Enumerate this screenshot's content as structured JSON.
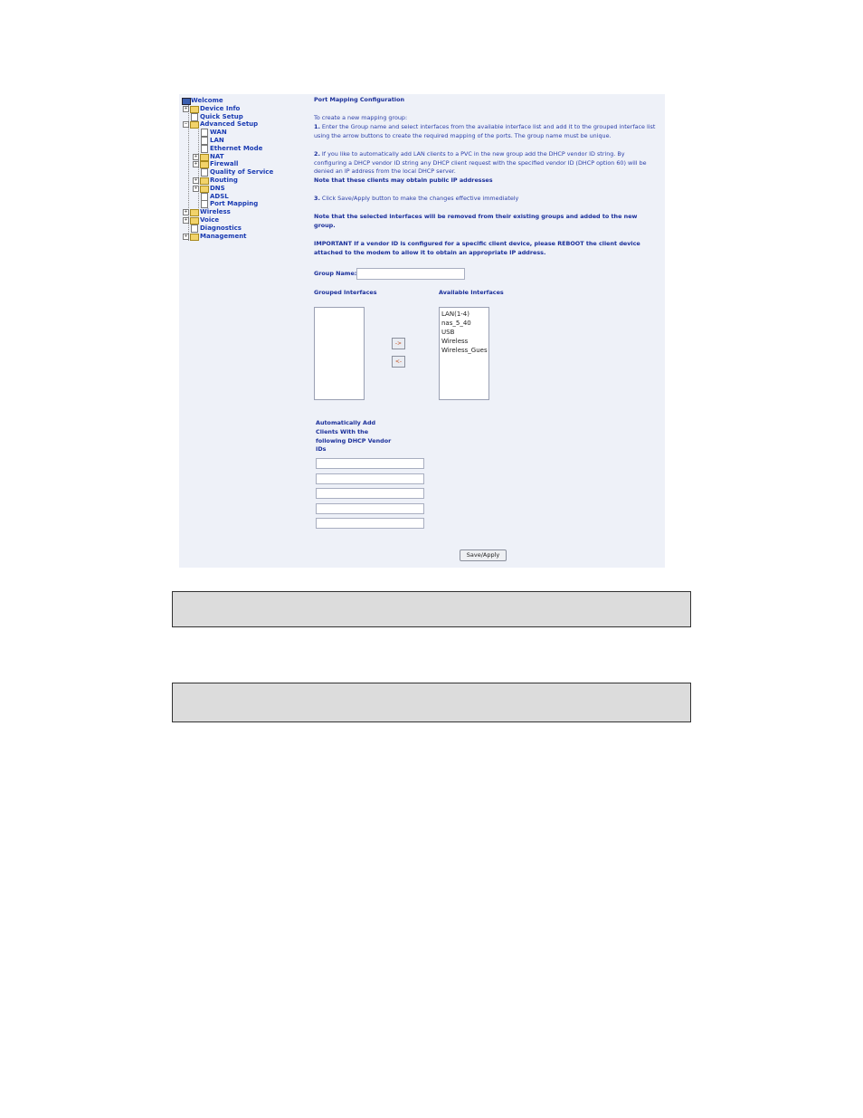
{
  "nav": {
    "items": {
      "welcome": "Welcome",
      "device_info": "Device Info",
      "quick_setup": "Quick Setup",
      "advanced_setup": "Advanced Setup",
      "wan": "WAN",
      "lan": "LAN",
      "ethernet_mode": "Ethernet Mode",
      "nat": "NAT",
      "firewall": "Firewall",
      "qos": "Quality of Service",
      "routing": "Routing",
      "dns": "DNS",
      "adsl": "ADSL",
      "port_mapping": "Port Mapping",
      "wireless": "Wireless",
      "voice": "Voice",
      "diagnostics": "Diagnostics",
      "management": "Management"
    }
  },
  "main": {
    "title": "Port Mapping Configuration",
    "intro": "To create a new mapping group:",
    "step1_num": "1.",
    "step1": "Enter the Group name and select interfaces from the available interface list and add it to the grouped interface list using the arrow buttons to create the required mapping of the ports. The group name must be unique.",
    "step2_num": "2.",
    "step2": "If you like to automatically add LAN clients to a PVC in the new group add the DHCP vendor ID string. By configuring a DHCP vendor ID string any DHCP client request with the specified vendor ID (DHCP option 60) will be denied an IP address from the local DHCP server.",
    "note_public": "Note that these clients may obtain public IP addresses",
    "step3_num": "3.",
    "step3": "Click Save/Apply button to make the changes effective immediately",
    "note_removed": "Note that the selected interfaces will be removed from their existing groups and added to the new group.",
    "important": "IMPORTANT If a vendor ID is configured for a specific client device, please REBOOT the client device attached to the modem to allow it to obtain an appropriate IP address.",
    "group_name_label": "Group Name:",
    "group_name_value": "",
    "grouped_label": "Grouped Interfaces",
    "available_label": "Available Interfaces",
    "available": [
      "LAN(1-4)",
      "nas_5_40",
      "USB",
      "Wireless",
      "Wireless_Gues"
    ],
    "move_right": "->",
    "move_left": "<-",
    "dhcp_label": "Automatically Add Clients With the following DHCP Vendor IDs",
    "vendor_ids": [
      "",
      "",
      "",
      "",
      ""
    ],
    "save_button": "Save/Apply"
  }
}
